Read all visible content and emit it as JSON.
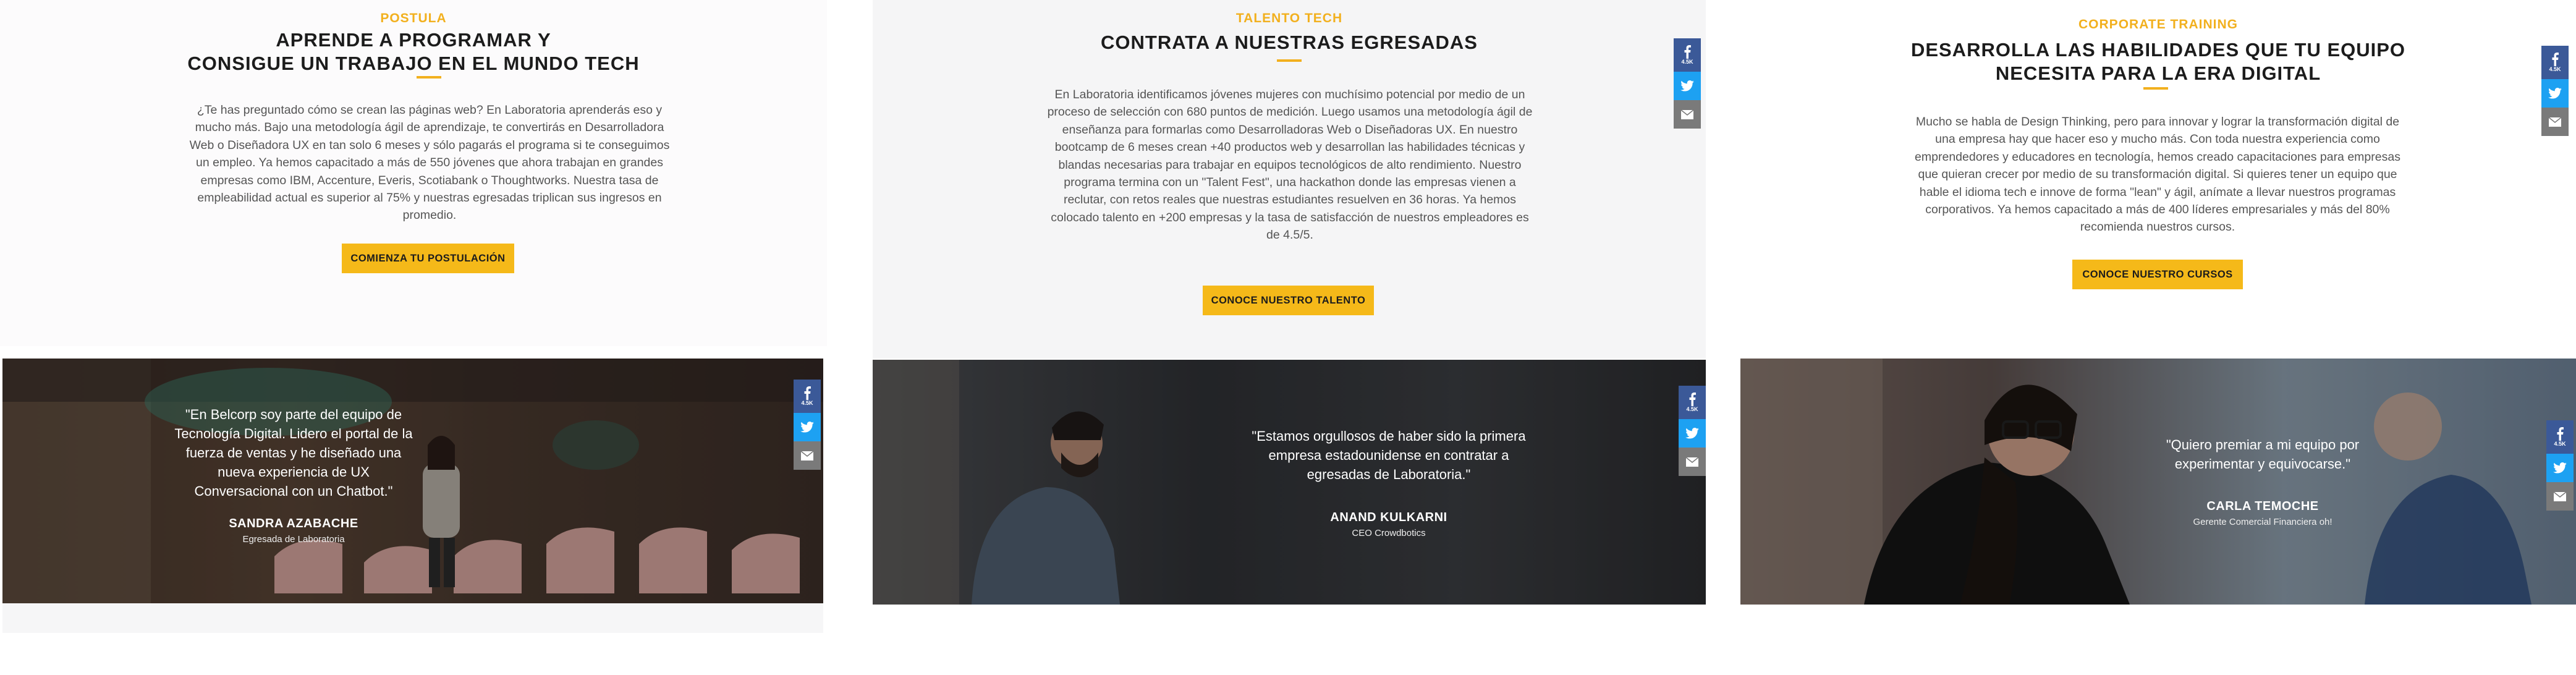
{
  "panels": [
    {
      "eyebrow": "POSTULA",
      "headline_lines": [
        "APRENDE A PROGRAMAR Y",
        "CONSIGUE UN TRABAJO EN EL MUNDO TECH"
      ],
      "body": "¿Te has preguntado cómo se crean las páginas web? En Laboratoria aprenderás eso y mucho más. Bajo una metodología ágil de aprendizaje, te convertirás en Desarrolladora Web o Diseñadora UX en tan solo 6 meses y sólo pagarás el programa si te conseguimos un empleo. Ya hemos capacitado a más de 550 jóvenes que ahora trabajan en grandes empresas como IBM, Accenture, Everis, Scotiabank o Thoughtworks. Nuestra tasa de empleabilidad actual es superior al 75% y nuestras egresadas triplican sus ingresos en promedio.",
      "cta": "COMIENZA TU POSTULACIÓN",
      "testimonial": {
        "quote": "\"En Belcorp soy parte del equipo de Tecnología Digital. Lidero el portal de la fuerza de ventas y he diseñado una nueva experiencia de UX Conversacional con un Chatbot.\"",
        "name": "SANDRA AZABACHE",
        "role": "Egresada de Laboratoria"
      },
      "share": {
        "facebook_count": "4.5K"
      }
    },
    {
      "eyebrow": "TALENTO TECH",
      "headline_lines": [
        "CONTRATA A NUESTRAS EGRESADAS"
      ],
      "body": "En Laboratoria identificamos jóvenes mujeres con muchísimo potencial por medio de un proceso de selección con 680 puntos de medición. Luego usamos una metodología ágil de enseñanza para formarlas como Desarrolladoras Web o Diseñadoras UX. En nuestro bootcamp de 6 meses crean +40 productos web y desarrollan las habilidades técnicas y blandas necesarias para trabajar en equipos tecnológicos de alto rendimiento. Nuestro programa termina con un \"Talent Fest\", una hackathon donde las empresas vienen a reclutar, con retos reales que nuestras estudiantes resuelven en 36 horas. Ya hemos colocado talento en +200 empresas y la tasa de satisfacción de nuestros empleadores es de 4.5/5.",
      "cta": "CONOCE NUESTRO TALENTO",
      "testimonial": {
        "quote": "\"Estamos orgullosos de haber sido la primera empresa estadounidense en contratar a egresadas de Laboratoria.\"",
        "name": "ANAND KULKARNI",
        "role": "CEO Crowdbotics"
      },
      "share": {
        "facebook_count": "4.5K"
      }
    },
    {
      "eyebrow": "CORPORATE TRAINING",
      "headline_lines": [
        "DESARROLLA LAS HABILIDADES QUE TU EQUIPO",
        "NECESITA PARA LA ERA DIGITAL"
      ],
      "body": "Mucho se habla de Design Thinking, pero para innovar y lograr la transformación digital de una empresa hay que hacer eso y mucho más. Con toda nuestra experiencia como emprendedores y educadores en tecnología, hemos creado capacitaciones para empresas que quieran crecer por medio de su transformación digital. Si quieres tener un equipo que hable el idioma tech e innove de forma \"lean\" y ágil, anímate a llevar nuestros programas corporativos. Ya hemos capacitado a más de 400 líderes empresariales y más del 80% recomienda nuestros cursos.",
      "cta": "CONOCE NUESTRO CURSOS",
      "testimonial": {
        "quote": "\"Quiero premiar a mi equipo por experimentar y equivocarse.\"",
        "name": "CARLA TEMOCHE",
        "role": "Gerente Comercial Financiera oh!"
      },
      "share": {
        "facebook_count": "4.5K"
      }
    }
  ],
  "colors": {
    "accent": "#f2b01e",
    "facebook": "#3b5998",
    "twitter": "#1da1f2",
    "mail": "#7a7a7a"
  },
  "icons": {
    "facebook": "facebook-icon",
    "twitter": "twitter-icon",
    "mail": "mail-icon"
  }
}
